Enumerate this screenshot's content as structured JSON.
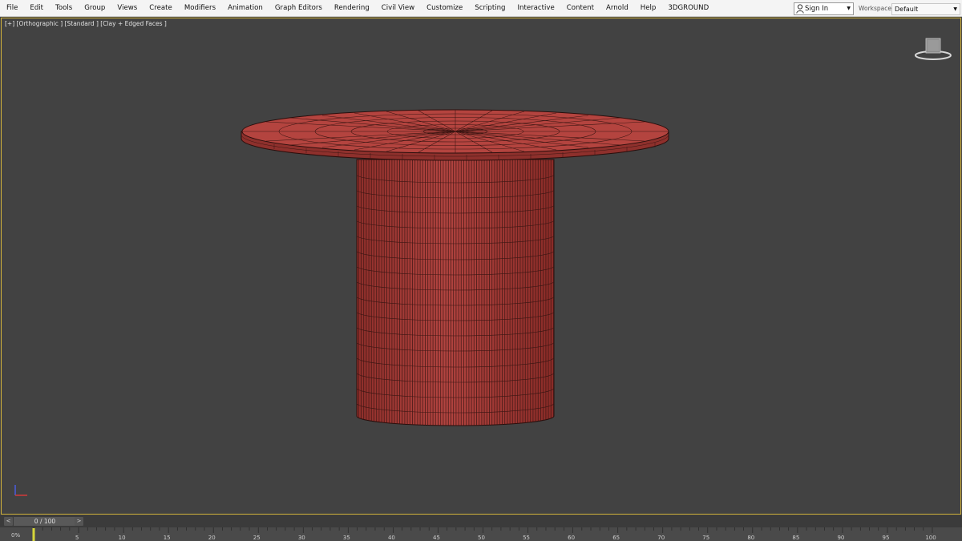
{
  "menu": {
    "items": [
      "File",
      "Edit",
      "Tools",
      "Group",
      "Views",
      "Create",
      "Modifiers",
      "Animation",
      "Graph Editors",
      "Rendering",
      "Civil View",
      "Customize",
      "Scripting",
      "Interactive",
      "Content",
      "Arnold",
      "Help",
      "3DGROUND"
    ],
    "sign_in": "Sign In",
    "workspaces_label": "Workspaces:",
    "workspace_value": "Default"
  },
  "viewport": {
    "label": "[+] [Orthographic ] [Standard ] [Clay + Edged Faces ]",
    "object_color": "#a83a35",
    "wire_color": "#3a1512"
  },
  "timeslider": {
    "display": "0 / 100",
    "prev": "<",
    "next": ">"
  },
  "trackbar": {
    "ticks": [
      "5",
      "10",
      "15",
      "20",
      "25",
      "30",
      "35",
      "40",
      "45",
      "50",
      "55",
      "60",
      "65",
      "70",
      "75",
      "80",
      "85",
      "90",
      "95",
      "100"
    ],
    "start_marker": "0%"
  },
  "colors": {
    "accent_border": "#d2b23c",
    "timeline_marker": "#d6d63a"
  }
}
